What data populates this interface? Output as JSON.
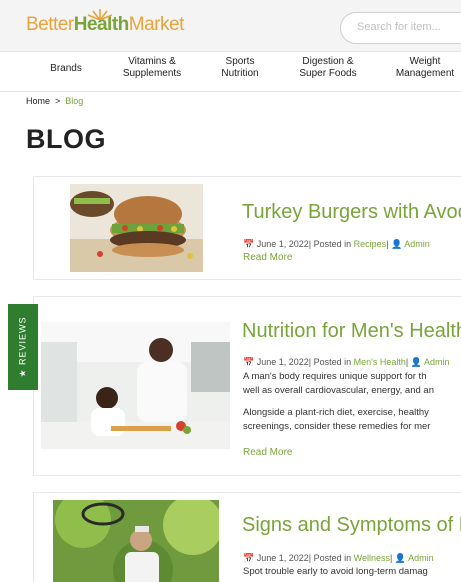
{
  "header": {
    "logo": {
      "part1": "Better",
      "part2": "Health",
      "part3": "Market"
    },
    "search_placeholder": "Search for item..."
  },
  "nav": [
    {
      "line1": "Brands",
      "line2": ""
    },
    {
      "line1": "Vitamins &",
      "line2": "Supplements"
    },
    {
      "line1": "Sports",
      "line2": "Nutrition"
    },
    {
      "line1": "Digestion &",
      "line2": "Super Foods"
    },
    {
      "line1": "Weight",
      "line2": "Management"
    }
  ],
  "breadcrumb": {
    "home": "Home",
    "sep": ">",
    "current": "Blog"
  },
  "page_title": "BLOG",
  "reviews_tab": "★ REVIEWS",
  "posts": [
    {
      "title": "Turkey Burgers with Avoc",
      "date": "June 1, 2022",
      "posted_in": "| Posted in",
      "category": "Recipes",
      "author": "Admin",
      "excerpt": [],
      "read_more": "Read More"
    },
    {
      "title": "Nutrition for Men's Health",
      "date": "June 1, 2022",
      "posted_in": "| Posted in",
      "category": "Men's Health",
      "author": "Admin",
      "excerpt": [
        "A man's body requires unique support for th",
        "well as overall cardiovascular, energy, and an",
        "Alongside a plant-rich diet, exercise, healthy",
        "screenings, consider these remedies for mer"
      ],
      "read_more": "Read More"
    },
    {
      "title": "Signs and Symptoms of L",
      "date": "June 1, 2022",
      "posted_in": "| Posted in",
      "category": "Wellness",
      "author": "Admin",
      "excerpt": [
        "Spot trouble early to avoid long-term damag"
      ],
      "read_more": ""
    }
  ],
  "colors": {
    "brand_green": "#7aa43a",
    "brand_orange": "#e8a33a",
    "tab_green": "#2f7d2f"
  }
}
